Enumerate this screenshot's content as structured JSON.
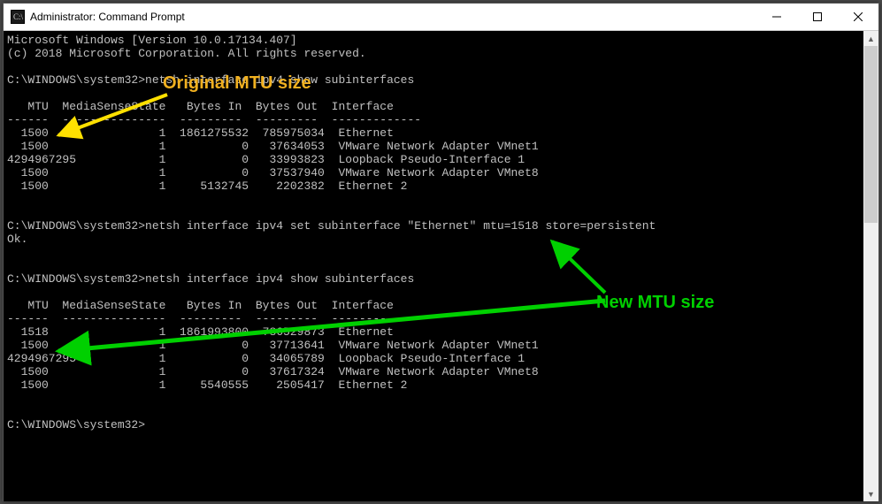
{
  "window": {
    "title": "Administrator: Command Prompt"
  },
  "callouts": {
    "original": "Original MTU size",
    "new": "New MTU size"
  },
  "terminal": {
    "version_line": "Microsoft Windows [Version 10.0.17134.407]",
    "copyright_line": "(c) 2018 Microsoft Corporation. All rights reserved.",
    "prompt_path": "C:\\WINDOWS\\system32>",
    "cmd_show": "netsh interface ipv4 show subinterfaces",
    "cmd_set": "netsh interface ipv4 set subinterface \"Ethernet\" mtu=1518 store=persistent",
    "ok": "Ok.",
    "header": "   MTU  MediaSenseState   Bytes In  Bytes Out  Interface",
    "divider": "------  ---------------  ---------  ---------  -------------",
    "table1": [
      {
        "mtu": "1500",
        "mss": "1",
        "bin": "1861275532",
        "bout": "785975034",
        "iface": "Ethernet"
      },
      {
        "mtu": "1500",
        "mss": "1",
        "bin": "0",
        "bout": "37634053",
        "iface": "VMware Network Adapter VMnet1"
      },
      {
        "mtu": "4294967295",
        "mss": "1",
        "bin": "0",
        "bout": "33993823",
        "iface": "Loopback Pseudo-Interface 1"
      },
      {
        "mtu": "1500",
        "mss": "1",
        "bin": "0",
        "bout": "37537940",
        "iface": "VMware Network Adapter VMnet8"
      },
      {
        "mtu": "1500",
        "mss": "1",
        "bin": "5132745",
        "bout": "2202382",
        "iface": "Ethernet 2"
      }
    ],
    "table2": [
      {
        "mtu": "1518",
        "mss": "1",
        "bin": "1861993800",
        "bout": "786529873",
        "iface": "Ethernet"
      },
      {
        "mtu": "1500",
        "mss": "1",
        "bin": "0",
        "bout": "37713641",
        "iface": "VMware Network Adapter VMnet1"
      },
      {
        "mtu": "4294967295",
        "mss": "1",
        "bin": "0",
        "bout": "34065789",
        "iface": "Loopback Pseudo-Interface 1"
      },
      {
        "mtu": "1500",
        "mss": "1",
        "bin": "0",
        "bout": "37617324",
        "iface": "VMware Network Adapter VMnet8"
      },
      {
        "mtu": "1500",
        "mss": "1",
        "bin": "5540555",
        "bout": "2505417",
        "iface": "Ethernet 2"
      }
    ]
  }
}
